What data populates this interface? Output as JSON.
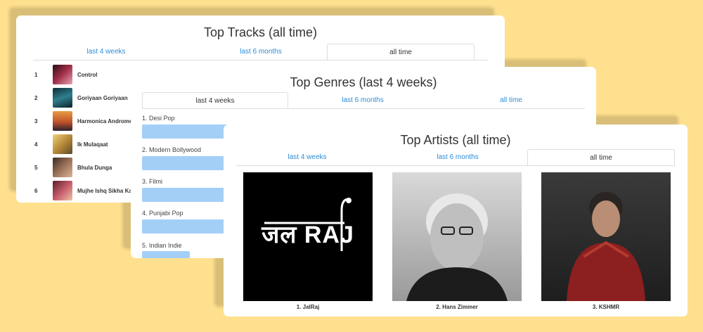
{
  "colors": {
    "background": "#ffe08e",
    "link": "#2d8cd6",
    "bar": "#a3cff7"
  },
  "tracks_card": {
    "title": "Top Tracks (all time)",
    "tabs": [
      {
        "label": "last 4 weeks",
        "active": false
      },
      {
        "label": "last 6 months",
        "active": false
      },
      {
        "label": "all time",
        "active": true
      }
    ],
    "tracks": [
      {
        "rank": "1",
        "name": "Control",
        "thumb_color": "#7a2333"
      },
      {
        "rank": "2",
        "name": "Goriyaan Goriyaan",
        "thumb_color": "#1f5a6b"
      },
      {
        "rank": "3",
        "name": "Harmonica Andromeda",
        "thumb_color": "#d8742f"
      },
      {
        "rank": "4",
        "name": "Ik Mulaqaat",
        "thumb_color": "#c9a24a"
      },
      {
        "rank": "5",
        "name": "Bhula Dunga",
        "thumb_color": "#6e4a3c"
      },
      {
        "rank": "6",
        "name": "Mujhe Ishq Sikha Karke",
        "thumb_color": "#8c3340"
      }
    ]
  },
  "genres_card": {
    "title": "Top Genres (last 4 weeks)",
    "tabs": [
      {
        "label": "last 4 weeks",
        "active": true
      },
      {
        "label": "last 6 months",
        "active": false
      },
      {
        "label": "all time",
        "active": false
      }
    ],
    "genres": [
      {
        "label": "1. Desi Pop",
        "share": 1.0
      },
      {
        "label": "2. Modern Bollywood",
        "share": 1.0
      },
      {
        "label": "3. Filmi",
        "share": 1.0
      },
      {
        "label": "4. Punjabi Pop",
        "share": 1.0
      },
      {
        "label": "5. Indian Indie",
        "share": 0.11
      }
    ]
  },
  "artists_card": {
    "title": "Top Artists (all time)",
    "tabs": [
      {
        "label": "last 4 weeks",
        "active": false
      },
      {
        "label": "last 6 months",
        "active": false
      },
      {
        "label": "all time",
        "active": true
      }
    ],
    "artists": [
      {
        "name": "1. JalRaj",
        "logo_text": "JalRaj"
      },
      {
        "name": "2. Hans Zimmer"
      },
      {
        "name": "3. KSHMR"
      }
    ]
  }
}
